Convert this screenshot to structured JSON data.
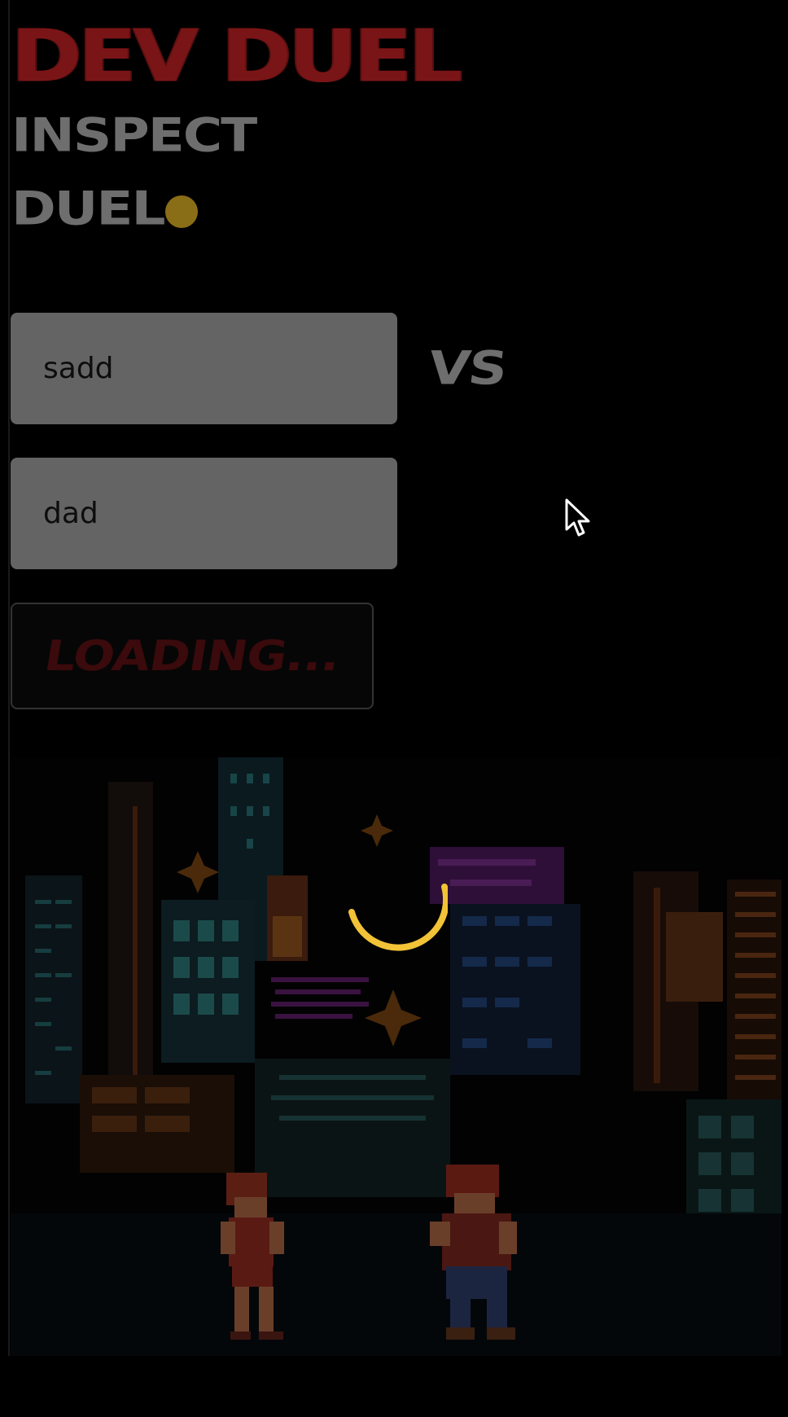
{
  "app": {
    "title": "DEV DUEL"
  },
  "nav": {
    "items": [
      {
        "label": "INSPECT"
      },
      {
        "label": "DUEL"
      }
    ],
    "status_dot_color": "#8a6d17"
  },
  "form": {
    "player_one": {
      "value": "sadd"
    },
    "player_two": {
      "value": "dad"
    },
    "vs_label": "VS",
    "submit_label": "LOADING..."
  },
  "colors": {
    "title": "#7a1517",
    "nav": "#6e6e6e",
    "input_bg": "#646464",
    "button_text": "#3b0a0c",
    "spinner": "#f2c237"
  },
  "icons": {
    "cursor": "mouse-pointer-icon",
    "spinner": "loading-spinner-icon"
  }
}
